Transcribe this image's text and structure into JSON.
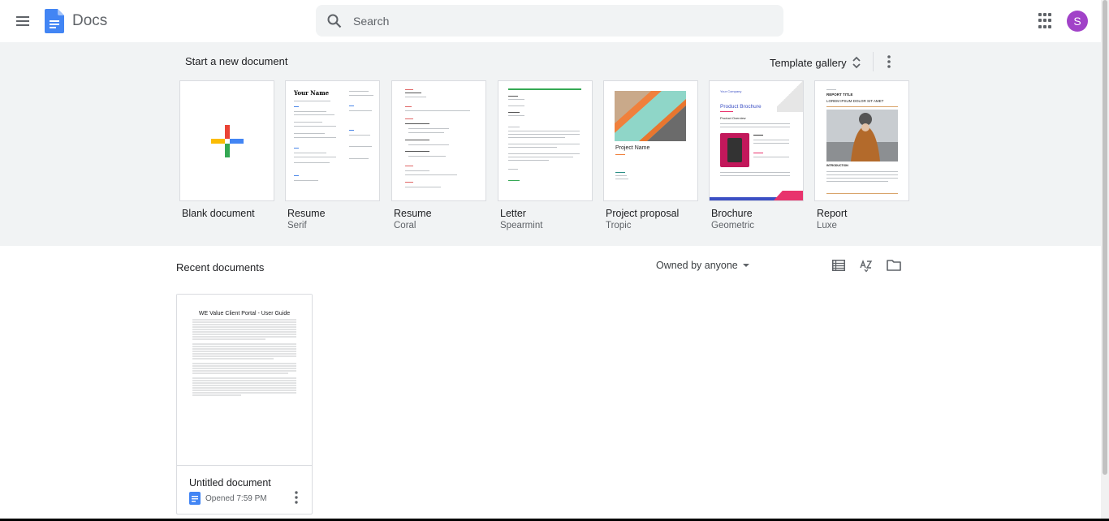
{
  "app": {
    "name": "Docs",
    "avatar_initial": "S",
    "avatar_color": "#a142c8",
    "brand_color": "#4285f4"
  },
  "search": {
    "placeholder": "Search"
  },
  "templates": {
    "heading": "Start a new document",
    "gallery_label": "Template gallery",
    "items": [
      {
        "name": "Blank document",
        "subtitle": ""
      },
      {
        "name": "Resume",
        "subtitle": "Serif",
        "preview_heading": "Your Name"
      },
      {
        "name": "Resume",
        "subtitle": "Coral"
      },
      {
        "name": "Letter",
        "subtitle": "Spearmint"
      },
      {
        "name": "Project proposal",
        "subtitle": "Tropic",
        "preview_heading": "Project Name"
      },
      {
        "name": "Brochure",
        "subtitle": "Geometric",
        "preview_company": "Your Company",
        "preview_heading": "Product Brochure",
        "preview_section": "Product Overview"
      },
      {
        "name": "Report",
        "subtitle": "Luxe",
        "preview_heading": "REPORT TITLE",
        "preview_subheading": "LOREM IPSUM DOLOR SIT AMET",
        "preview_section": "INTRODUCTION"
      }
    ]
  },
  "recent": {
    "heading": "Recent documents",
    "owner_filter": "Owned by anyone",
    "documents": [
      {
        "title": "Untitled document",
        "opened": "Opened 7:59 PM",
        "preview_title": "WE Value Client Portal - User Guide"
      }
    ]
  }
}
